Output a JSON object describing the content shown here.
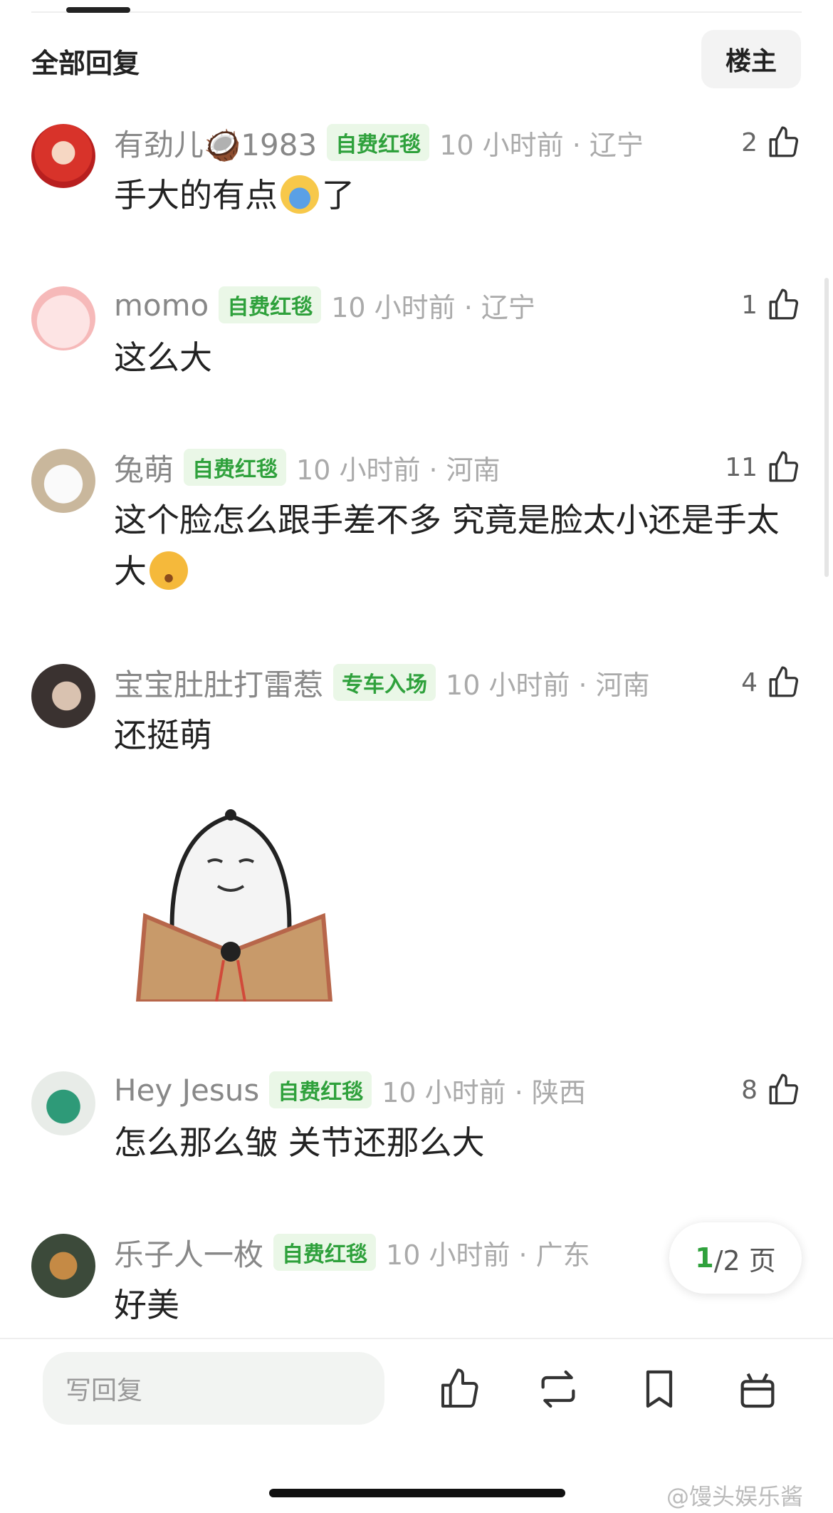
{
  "header": {
    "title": "全部回复",
    "op_button": "楼主"
  },
  "comments": [
    {
      "user": "有劲儿🥥1983",
      "badge": "自费红毯",
      "time": "10 小时前 · 辽宁",
      "likes": "2",
      "text": "手大的有点",
      "text_after": "了",
      "emoji": "scream-emoji"
    },
    {
      "user": "momo",
      "badge": "自费红毯",
      "time": "10 小时前 · 辽宁",
      "likes": "1",
      "text": "这么大"
    },
    {
      "user": "兔萌",
      "badge": "自费红毯",
      "time": "10 小时前 · 河南",
      "likes": "11",
      "text": "这个脸怎么跟手差不多 究竟是脸太小还是手太大",
      "emoji": "worried-emoji"
    },
    {
      "user": "宝宝肚肚打雷惹",
      "badge": "专车入场",
      "time": "10 小时前 · 河南",
      "likes": "4",
      "text": "还挺萌"
    },
    {
      "user": "Hey Jesus",
      "badge": "自费红毯",
      "time": "10 小时前 · 陕西",
      "likes": "8",
      "text": "怎么那么皱 关节还那么大"
    },
    {
      "user": "乐子人一枚",
      "badge": "自费红毯",
      "time": "10 小时前 · 广东",
      "likes": "",
      "text": "好美"
    }
  ],
  "pagination": {
    "current": "1",
    "rest": "/2 页"
  },
  "toolbar": {
    "reply_placeholder": "写回复"
  },
  "watermark": "@馒头娱乐酱",
  "colors": {
    "accent": "#2fa13c",
    "badge_bg": "#eaf7e7"
  }
}
